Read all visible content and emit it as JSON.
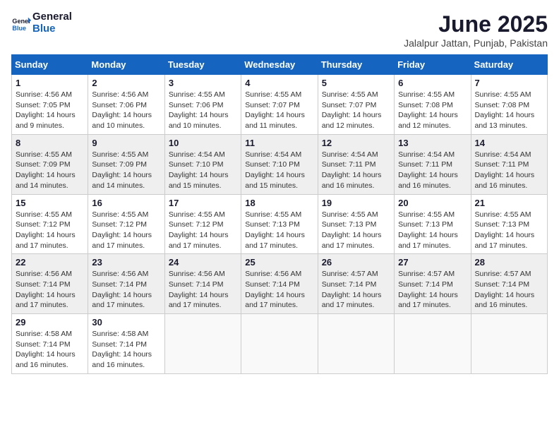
{
  "logo": {
    "line1": "General",
    "line2": "Blue"
  },
  "title": "June 2025",
  "subtitle": "Jalalpur Jattan, Punjab, Pakistan",
  "weekdays": [
    "Sunday",
    "Monday",
    "Tuesday",
    "Wednesday",
    "Thursday",
    "Friday",
    "Saturday"
  ],
  "weeks": [
    [
      {
        "day": "1",
        "sunrise": "4:56 AM",
        "sunset": "7:05 PM",
        "daylight": "14 hours and 9 minutes."
      },
      {
        "day": "2",
        "sunrise": "4:56 AM",
        "sunset": "7:06 PM",
        "daylight": "14 hours and 10 minutes."
      },
      {
        "day": "3",
        "sunrise": "4:55 AM",
        "sunset": "7:06 PM",
        "daylight": "14 hours and 10 minutes."
      },
      {
        "day": "4",
        "sunrise": "4:55 AM",
        "sunset": "7:07 PM",
        "daylight": "14 hours and 11 minutes."
      },
      {
        "day": "5",
        "sunrise": "4:55 AM",
        "sunset": "7:07 PM",
        "daylight": "14 hours and 12 minutes."
      },
      {
        "day": "6",
        "sunrise": "4:55 AM",
        "sunset": "7:08 PM",
        "daylight": "14 hours and 12 minutes."
      },
      {
        "day": "7",
        "sunrise": "4:55 AM",
        "sunset": "7:08 PM",
        "daylight": "14 hours and 13 minutes."
      }
    ],
    [
      {
        "day": "8",
        "sunrise": "4:55 AM",
        "sunset": "7:09 PM",
        "daylight": "14 hours and 14 minutes."
      },
      {
        "day": "9",
        "sunrise": "4:55 AM",
        "sunset": "7:09 PM",
        "daylight": "14 hours and 14 minutes."
      },
      {
        "day": "10",
        "sunrise": "4:54 AM",
        "sunset": "7:10 PM",
        "daylight": "14 hours and 15 minutes."
      },
      {
        "day": "11",
        "sunrise": "4:54 AM",
        "sunset": "7:10 PM",
        "daylight": "14 hours and 15 minutes."
      },
      {
        "day": "12",
        "sunrise": "4:54 AM",
        "sunset": "7:11 PM",
        "daylight": "14 hours and 16 minutes."
      },
      {
        "day": "13",
        "sunrise": "4:54 AM",
        "sunset": "7:11 PM",
        "daylight": "14 hours and 16 minutes."
      },
      {
        "day": "14",
        "sunrise": "4:54 AM",
        "sunset": "7:11 PM",
        "daylight": "14 hours and 16 minutes."
      }
    ],
    [
      {
        "day": "15",
        "sunrise": "4:55 AM",
        "sunset": "7:12 PM",
        "daylight": "14 hours and 17 minutes."
      },
      {
        "day": "16",
        "sunrise": "4:55 AM",
        "sunset": "7:12 PM",
        "daylight": "14 hours and 17 minutes."
      },
      {
        "day": "17",
        "sunrise": "4:55 AM",
        "sunset": "7:12 PM",
        "daylight": "14 hours and 17 minutes."
      },
      {
        "day": "18",
        "sunrise": "4:55 AM",
        "sunset": "7:13 PM",
        "daylight": "14 hours and 17 minutes."
      },
      {
        "day": "19",
        "sunrise": "4:55 AM",
        "sunset": "7:13 PM",
        "daylight": "14 hours and 17 minutes."
      },
      {
        "day": "20",
        "sunrise": "4:55 AM",
        "sunset": "7:13 PM",
        "daylight": "14 hours and 17 minutes."
      },
      {
        "day": "21",
        "sunrise": "4:55 AM",
        "sunset": "7:13 PM",
        "daylight": "14 hours and 17 minutes."
      }
    ],
    [
      {
        "day": "22",
        "sunrise": "4:56 AM",
        "sunset": "7:14 PM",
        "daylight": "14 hours and 17 minutes."
      },
      {
        "day": "23",
        "sunrise": "4:56 AM",
        "sunset": "7:14 PM",
        "daylight": "14 hours and 17 minutes."
      },
      {
        "day": "24",
        "sunrise": "4:56 AM",
        "sunset": "7:14 PM",
        "daylight": "14 hours and 17 minutes."
      },
      {
        "day": "25",
        "sunrise": "4:56 AM",
        "sunset": "7:14 PM",
        "daylight": "14 hours and 17 minutes."
      },
      {
        "day": "26",
        "sunrise": "4:57 AM",
        "sunset": "7:14 PM",
        "daylight": "14 hours and 17 minutes."
      },
      {
        "day": "27",
        "sunrise": "4:57 AM",
        "sunset": "7:14 PM",
        "daylight": "14 hours and 17 minutes."
      },
      {
        "day": "28",
        "sunrise": "4:57 AM",
        "sunset": "7:14 PM",
        "daylight": "14 hours and 16 minutes."
      }
    ],
    [
      {
        "day": "29",
        "sunrise": "4:58 AM",
        "sunset": "7:14 PM",
        "daylight": "14 hours and 16 minutes."
      },
      {
        "day": "30",
        "sunrise": "4:58 AM",
        "sunset": "7:14 PM",
        "daylight": "14 hours and 16 minutes."
      },
      null,
      null,
      null,
      null,
      null
    ]
  ]
}
